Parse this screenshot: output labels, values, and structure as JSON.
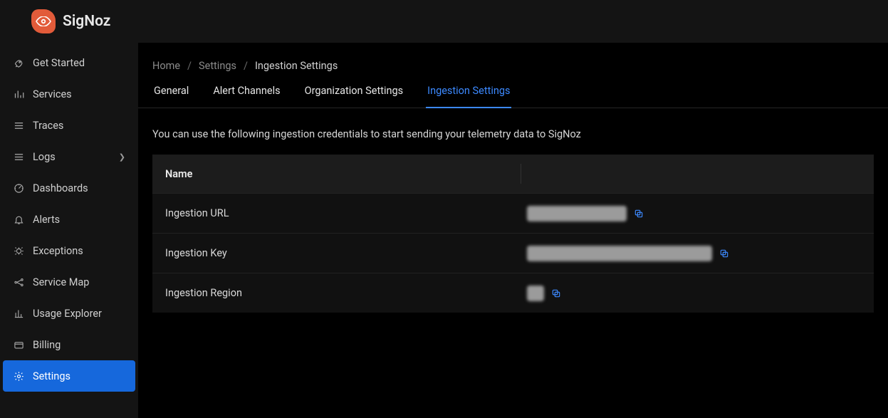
{
  "brand": {
    "name": "SigNoz"
  },
  "sidebar": {
    "items": [
      {
        "label": "Get Started",
        "icon": "rocket-icon"
      },
      {
        "label": "Services",
        "icon": "bars-icon"
      },
      {
        "label": "Traces",
        "icon": "menu-icon"
      },
      {
        "label": "Logs",
        "icon": "menu-icon",
        "expandable": true
      },
      {
        "label": "Dashboards",
        "icon": "dashboard-icon"
      },
      {
        "label": "Alerts",
        "icon": "bell-icon"
      },
      {
        "label": "Exceptions",
        "icon": "bug-icon"
      },
      {
        "label": "Service Map",
        "icon": "map-icon"
      },
      {
        "label": "Usage Explorer",
        "icon": "chart-icon"
      },
      {
        "label": "Billing",
        "icon": "card-icon"
      },
      {
        "label": "Settings",
        "icon": "gear-icon",
        "active": true
      }
    ]
  },
  "breadcrumb": {
    "items": [
      "Home",
      "Settings",
      "Ingestion Settings"
    ]
  },
  "tabs": {
    "items": [
      {
        "label": "General"
      },
      {
        "label": "Alert Channels"
      },
      {
        "label": "Organization Settings"
      },
      {
        "label": "Ingestion Settings",
        "active": true
      }
    ]
  },
  "description": "You can use the following ingestion credentials to start sending your telemetry data to SigNoz",
  "table": {
    "header": {
      "name": "Name"
    },
    "rows": [
      {
        "name": "Ingestion URL",
        "redactedWidth": 140
      },
      {
        "name": "Ingestion Key",
        "redactedWidth": 260
      },
      {
        "name": "Ingestion Region",
        "redactedWidth": 24
      }
    ]
  }
}
